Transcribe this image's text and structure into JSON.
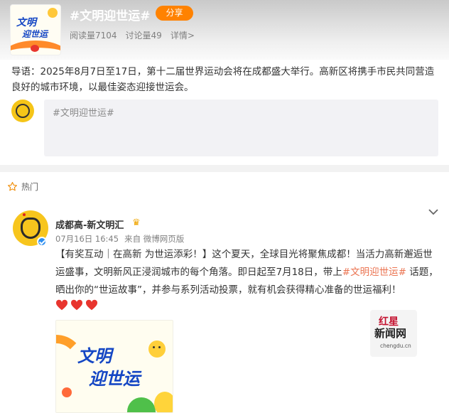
{
  "topic": {
    "title": "#文明迎世运#",
    "share_label": "分享",
    "reads": "阅读量7104",
    "discussions": "讨论量49",
    "details_link": "详情>",
    "cover_text_line1": "文明",
    "cover_text_line2": "迎世运"
  },
  "intro": "导语：2025年8月7日至17日，第十二届世界运动会将在成都盛大举行。高新区将携手市民共同营造良好的城市环境，以最佳姿态迎接世运会。",
  "composer": {
    "prefill": "#文明迎世运#"
  },
  "hot_section": {
    "label": "热门"
  },
  "post": {
    "author": "成都高-新文明汇",
    "date": "07月16日 16:45",
    "source": "来自 微博网页版",
    "text_part1": "【有奖互动｜在高新 为世运添彩！】这个夏天，全球目光将聚焦成都！当活力高新邂逅世运盛事，文明新风正浸润城市的每个角落。即日起至7月18日，带上",
    "topic_link": "#文明迎世运#",
    "text_part2": " 话题，晒出你的“世运故事”，并参与系列活动投票，就有机会获得精心准备的世运福利！",
    "image_text_line1": "文明",
    "image_text_line2": "迎世运"
  },
  "watermark": {
    "line1": "红星",
    "line2": "新闻网",
    "line3": "chengdu.cn"
  },
  "colors": {
    "accent_orange": "#ff8200",
    "link": "#eb7350",
    "verified_blue": "#2e8ff0",
    "brand_blue": "#1446c4"
  },
  "icons": [
    "star-outline-icon",
    "chevron-down-icon",
    "crown-badge-icon",
    "verified-badge-icon",
    "red-heart-icon"
  ]
}
